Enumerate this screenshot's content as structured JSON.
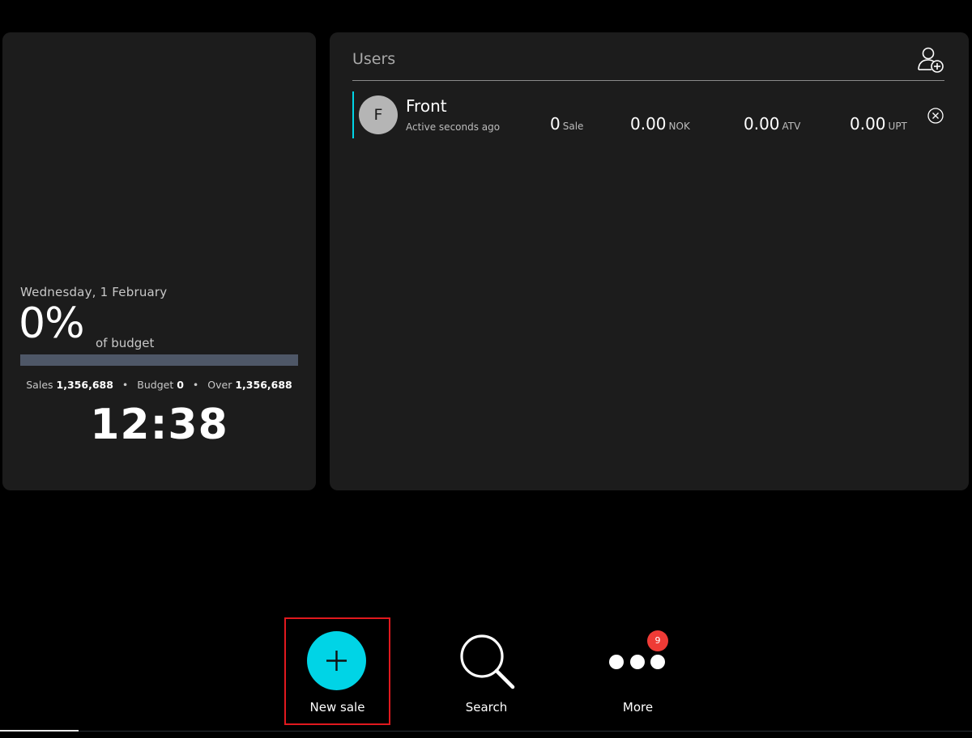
{
  "left_panel": {
    "date": "Wednesday, 1 February",
    "percent": "0%",
    "percent_suffix": "of budget",
    "budget_progress": 0,
    "stats": {
      "sales_label": "Sales",
      "sales_value": "1,356,688",
      "budget_label": "Budget",
      "budget_value": "0",
      "over_label": "Over",
      "over_value": "1,356,688",
      "separator": "•"
    },
    "clock": "12:38"
  },
  "users_panel": {
    "title": "Users",
    "add_user_icon": "add-user-icon",
    "users": [
      {
        "initial": "F",
        "name": "Front",
        "status": "Active seconds ago",
        "sales_count": "0",
        "sales_unit": "Sale",
        "amount": "0.00",
        "currency": "NOK",
        "atv": "0.00",
        "atv_unit": "ATV",
        "upt": "0.00",
        "upt_unit": "UPT",
        "remove_icon": "close-circle-icon"
      }
    ]
  },
  "bottom_bar": {
    "new_sale": {
      "label": "New sale",
      "icon": "plus-icon"
    },
    "search": {
      "label": "Search",
      "icon": "search-icon"
    },
    "more": {
      "label": "More",
      "icon": "more-dots-icon",
      "badge": "9"
    }
  },
  "colors": {
    "accent": "#00d4e6",
    "panel": "#1c1c1c",
    "badge": "#ef3b36",
    "selection_outline": "#e0191e",
    "budget_bar": "#4e5767"
  }
}
